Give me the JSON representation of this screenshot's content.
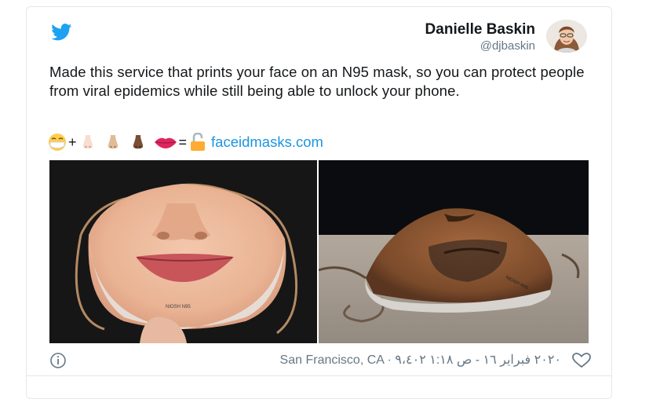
{
  "tweet": {
    "author_name": "Danielle Baskin",
    "author_handle": "@djbaskin",
    "text": "Made this service that prints your face on an N95 mask, so you can protect people from viral epidemics while still being able to unlock your phone.",
    "emoji_plus": "+",
    "emoji_equals": "=",
    "link_text": "faceidmasks.com",
    "photo_left_label": "NIOSH N95",
    "photo_right_label": "NIOSH N95",
    "meta": "San Francisco, CA · ٢٠٢٠ فبراير ١٦ - ص ١:١٨  ٩،٤٠٢"
  },
  "colors": {
    "twitter_blue": "#1da1f2",
    "link_blue": "#1b95e0",
    "secondary_text": "#657786",
    "border": "#e1e8ed"
  },
  "icons": [
    "twitter-bird-icon",
    "info-icon",
    "heart-icon",
    "reply-icon"
  ]
}
